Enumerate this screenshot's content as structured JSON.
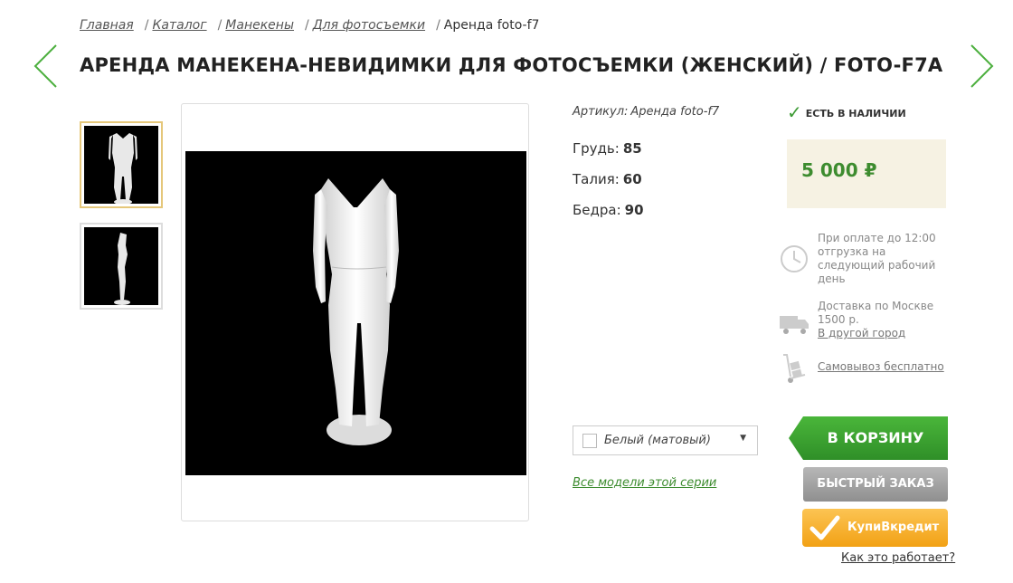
{
  "breadcrumb": {
    "items": [
      "Главная",
      "Каталог",
      "Манекены",
      "Для фотосъемки"
    ],
    "separator": "/",
    "current": "Аренда foto-f7"
  },
  "title": "АРЕНДА МАНЕКЕНА-НЕВИДИМКИ ДЛЯ ФОТОСЪЕМКИ (ЖЕНСКИЙ) / FOTO-F7A",
  "sku": {
    "label": "Артикул:",
    "value": "Аренда foto-f7"
  },
  "specs": [
    {
      "label": "Грудь:",
      "value": "85"
    },
    {
      "label": "Талия:",
      "value": "60"
    },
    {
      "label": "Бедра:",
      "value": "90"
    }
  ],
  "stock": "ЕСТЬ В НАЛИЧИИ",
  "price": "5 000 ₽",
  "info": {
    "shipping": "При оплате до 12:00 отгрузка на следующий рабочий день",
    "delivery_text": "Доставка по Москве 1500 р.",
    "delivery_link": "В другой город",
    "pickup_link": "Самовывоз бесплатно"
  },
  "color_select": {
    "value": "Белый (матовый)"
  },
  "series_link": "Все модели этой серии",
  "buttons": {
    "cart": "В КОРЗИНУ",
    "quick": "БЫСТРЫЙ ЗАКАЗ",
    "credit": "КупиВкредит",
    "how": "Как это работает?"
  },
  "colors": {
    "accent_green": "#3d8c2f",
    "price_bg": "#f6f2e3",
    "credit_orange": "#f5a623"
  },
  "icons": [
    "chevron-left-icon",
    "chevron-right-icon",
    "check-icon",
    "clock-icon",
    "truck-icon",
    "hand-truck-icon",
    "dropdown-arrow-icon"
  ]
}
